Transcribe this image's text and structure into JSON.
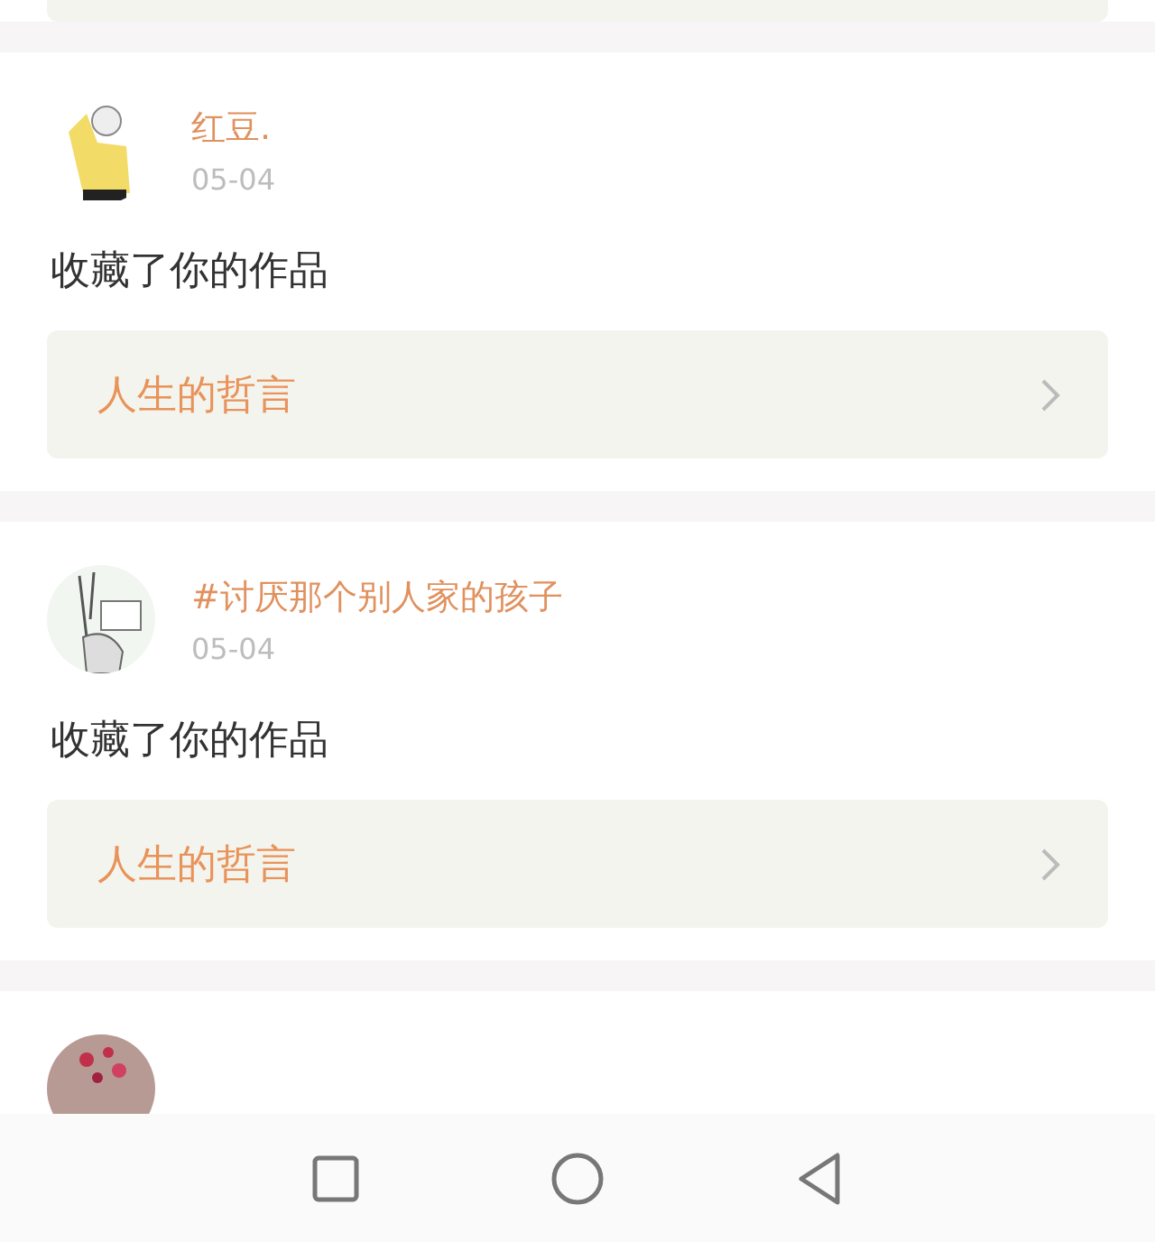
{
  "notifications": [
    {
      "avatar": {
        "kind": "picture"
      },
      "name": "红豆.",
      "date": "05-04",
      "action": "收藏了你的作品",
      "work": {
        "title": "人生的哲言"
      }
    },
    {
      "avatar": {
        "kind": "picture"
      },
      "name": "#讨厌那个别人家的孩子",
      "date": "05-04",
      "action": "收藏了你的作品",
      "work": {
        "title": "人生的哲言"
      }
    },
    {
      "avatar": {
        "kind": "picture"
      }
    }
  ],
  "nav_bar": {
    "buttons": [
      {
        "kind": "square"
      },
      {
        "kind": "circle"
      },
      {
        "kind": "triangle"
      }
    ]
  }
}
